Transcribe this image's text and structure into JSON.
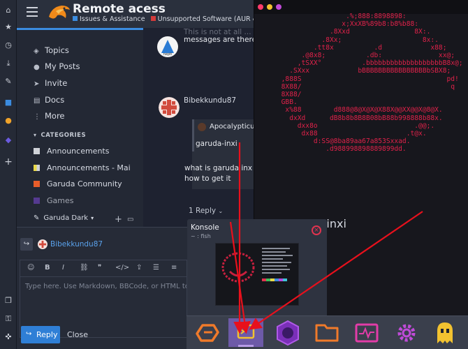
{
  "header": {
    "site_title": "Remote acess",
    "cat1": "Issues & Assistance",
    "cat2": "Unsupported Software (AUR & Othe",
    "cat1_color": "#3b8ce0",
    "cat2_color": "#d43b3b"
  },
  "sidebar": {
    "items": [
      {
        "icon": "layers-icon",
        "label": "Topics"
      },
      {
        "icon": "user-icon",
        "label": "My Posts"
      },
      {
        "icon": "send-icon",
        "label": "Invite"
      },
      {
        "icon": "book-icon",
        "label": "Docs"
      },
      {
        "icon": "kebab-icon",
        "label": "More"
      }
    ],
    "categories_heading": "CATEGORIES",
    "categories": [
      {
        "label": "Announcements",
        "color": "#cfd2d8"
      },
      {
        "label": "Announcements - Mai",
        "color": "#e8d94a"
      },
      {
        "label": "Garuda Community",
        "color": "#e85d2a"
      },
      {
        "label": "Games",
        "color": "#6b42b8"
      }
    ],
    "theme_label": "Garuda Dark"
  },
  "posts": {
    "post1_text_cut": "This is not at all ...",
    "post1_text": "messages are there?",
    "post2_author": "Bibekkundu87",
    "quote_author": "Apocalypticus",
    "quote_text": "garuda-inxi",
    "post2_line1": "what is garuda inx",
    "post2_line2": "how to get it",
    "replies_label": "1 Reply"
  },
  "composer": {
    "reply_to": "Bibekkundu87",
    "placeholder": "Type here. Use Markdown, BBCode, or HTML to fo",
    "reply_button": "Reply",
    "close_button": "Close"
  },
  "terminal": {
    "ascii_lines": [
      "                      .%;888:8898898:",
      "                     x;XxXB%89b8:b8%b88:",
      "                  .8Xxd                8X:.",
      "                .8Xx;                    8x:.",
      "              .tt8x          .d            x88;",
      "           .@8x8;          .db:              xx@;",
      "          ,tSXX°          .bbbbbbbbbbbbbbbbbbbB8x@;",
      "        .SXxx            bBBBBBBBBBBBBBBBBbSBX8;",
      "      ,888S                                    pd!",
      "      8X88/                                     q",
      "      8X88/",
      "      GBB.",
      "       x%88        d888@8@X@X@X88X@@XX@@X@8@X.",
      "        dxXd      dB8b8b8B8B08bB88b998888b88x.",
      "          dxx8o                        .@@;.",
      "           dx88                      .t@x.",
      "              d:SS@8ba89aa67a853Sxxad.",
      "                 .d988998898889899dd."
    ],
    "prompt_line": "  ~ > garuda-inxi"
  },
  "popup": {
    "title": "Konsole",
    "subtitle": "~ : fish"
  },
  "dock": {
    "items": [
      "garuda-launcher-icon",
      "konsole-icon",
      "garuda-gamer-icon",
      "file-manager-icon",
      "system-monitor-icon",
      "settings-icon",
      "ghost-icon"
    ]
  },
  "colors": {
    "accent": "#3b8ce0",
    "terminal_red": "#e0224a",
    "dock_active": "#8a6fc8"
  }
}
